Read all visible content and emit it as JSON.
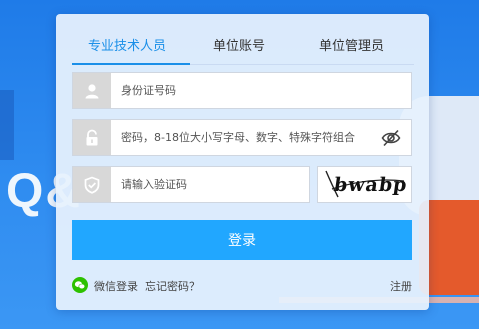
{
  "background": {
    "watermark_text": "Q&"
  },
  "tabs": [
    {
      "label": "专业技术人员",
      "active": true
    },
    {
      "label": "单位账号",
      "active": false
    },
    {
      "label": "单位管理员",
      "active": false
    }
  ],
  "form": {
    "id_placeholder": "身份证号码",
    "password_placeholder": "密码，8-18位大小写字母、数字、特殊字符组合",
    "captcha_placeholder": "请输入验证码",
    "captcha_text": "bwabp"
  },
  "login_label": "登录",
  "footer": {
    "wechat_login": "微信登录",
    "forgot_password": "忘记密码？",
    "register": "注册"
  },
  "colors": {
    "accent": "#21a7ff",
    "tab_active": "#1a8fe8",
    "wechat": "#2dc100"
  }
}
